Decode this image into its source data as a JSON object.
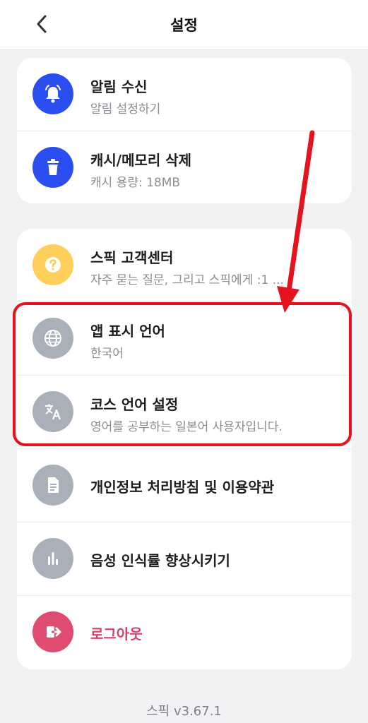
{
  "header": {
    "title": "설정"
  },
  "card1": {
    "items": [
      {
        "label": "알림 수신",
        "sub": "알림 설정하기",
        "icon": "bell-icon"
      },
      {
        "label": "캐시/메모리 삭제",
        "sub": "캐시 용량: 18MB",
        "icon": "trash-icon"
      }
    ]
  },
  "card2": {
    "items": [
      {
        "label": "스픽 고객센터",
        "sub": "자주 묻는 질문, 그리고 스픽에게 :1 ...",
        "icon": "question-icon"
      },
      {
        "label": "앱 표시 언어",
        "sub": "한국어",
        "icon": "globe-icon"
      },
      {
        "label": "코스 언어 설정",
        "sub": "영어를 공부하는 일본어 사용자입니다.",
        "icon": "translate-icon"
      },
      {
        "label": "개인정보 처리방침 및 이용약관",
        "icon": "document-icon"
      },
      {
        "label": "음성 인식률 향상시키기",
        "icon": "bar-chart-icon"
      },
      {
        "label": "로그아웃",
        "icon": "logout-icon"
      }
    ]
  },
  "footer": {
    "version": "스픽 v3.67.1"
  },
  "colors": {
    "accent_blue": "#2b4ef0",
    "help_yellow": "#ffcf5c",
    "neutral_gray": "#a9b0ba",
    "logout_red": "#e04b71",
    "annotation_red": "#e4141e"
  }
}
